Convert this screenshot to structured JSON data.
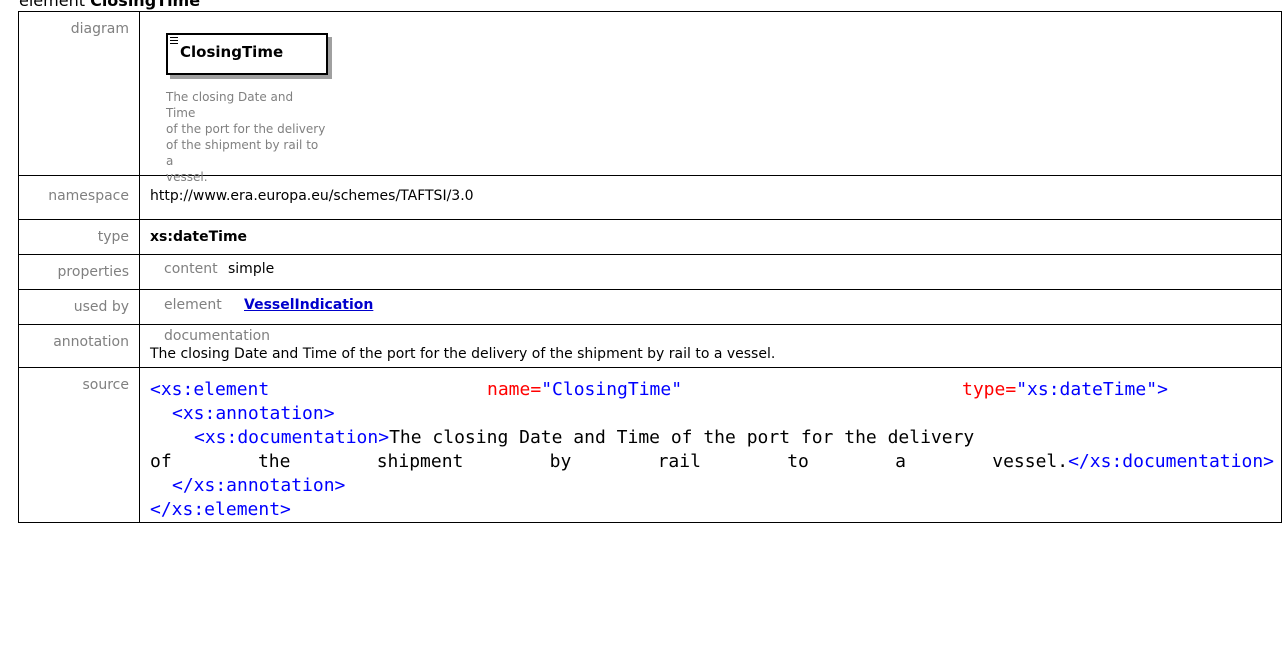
{
  "heading": {
    "prefix": "element",
    "name": "ClosingTime"
  },
  "labels": {
    "diagram": "diagram",
    "namespace": "namespace",
    "type": "type",
    "properties": "properties",
    "used_by": "used by",
    "annotation": "annotation",
    "source": "source"
  },
  "diagram": {
    "element_name": "ClosingTime",
    "doc_lines": [
      "The closing Date and Time",
      "of the port for the delivery",
      "of the shipment by rail to a",
      "vessel."
    ]
  },
  "namespace": "http://www.era.europa.eu/schemes/TAFTSI/3.0",
  "type": "xs:dateTime",
  "properties": {
    "key": "content",
    "value": "simple"
  },
  "used_by": {
    "key": "element",
    "value": "VesselIndication"
  },
  "annotation": {
    "key": "documentation",
    "text": "The closing Date and Time of the port for the delivery of the shipment by rail to a vessel."
  },
  "source": {
    "l1_tag": "<xs:element",
    "l1_attr1": "name=",
    "l1_val1": "\"ClosingTime\"",
    "l1_attr2": "type=",
    "l1_val2": "\"xs:dateTime\"",
    "l1_close": ">",
    "l2": "<xs:annotation>",
    "l3_open": "<xs:documentation>",
    "l3_text": "The closing Date and Time of the port for the delivery",
    "l4_words": [
      "of",
      "the",
      "shipment",
      "by",
      "rail",
      "to",
      "a"
    ],
    "l4_last": "vessel.",
    "l4_close": "</xs:documentation>",
    "l5": "</xs:annotation>",
    "l6": "</xs:element>"
  },
  "colors": {
    "tag": "#990000",
    "bracket": "#0000ff",
    "attribute": "#ff0000",
    "link": "#0000cc",
    "label": "#808080"
  }
}
